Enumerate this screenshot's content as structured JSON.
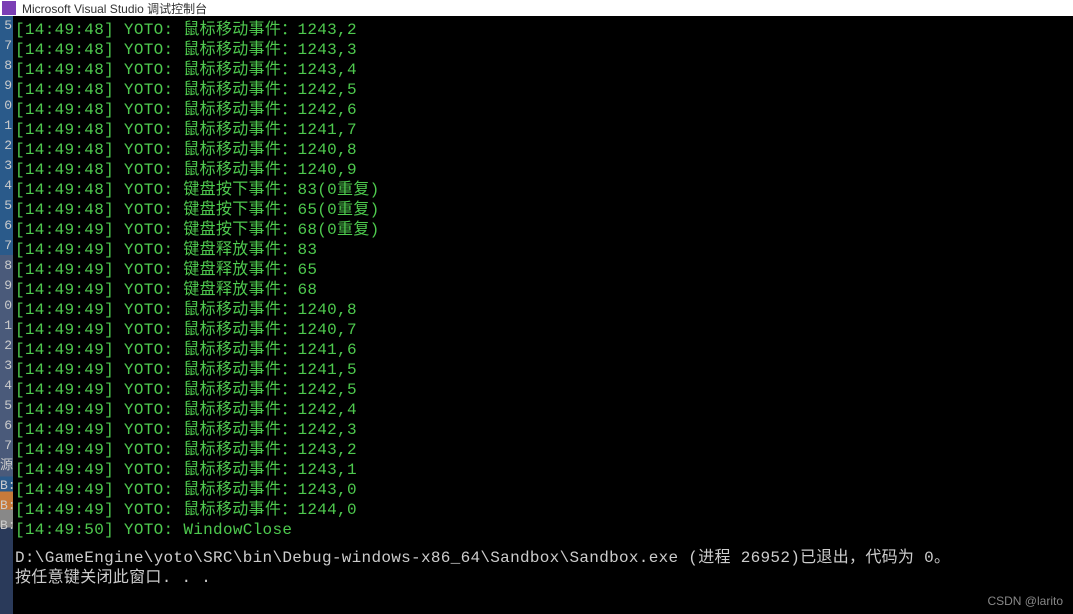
{
  "title": "Microsoft Visual Studio 调试控制台",
  "gutter": [
    "5",
    "7",
    "8",
    "9",
    "0",
    "1",
    "2",
    "3",
    "4",
    "5",
    "6",
    "7",
    "8",
    "9",
    "0",
    "1",
    "2",
    "3",
    "4",
    "5",
    "6",
    "7",
    "源",
    "B:",
    "B:",
    "B:"
  ],
  "logs": [
    {
      "ts": "[14:49:48]",
      "prefix": "YOTO:",
      "msg": "鼠标移动事件：1243,2"
    },
    {
      "ts": "[14:49:48]",
      "prefix": "YOTO:",
      "msg": "鼠标移动事件：1243,3"
    },
    {
      "ts": "[14:49:48]",
      "prefix": "YOTO:",
      "msg": "鼠标移动事件：1243,4"
    },
    {
      "ts": "[14:49:48]",
      "prefix": "YOTO:",
      "msg": "鼠标移动事件：1242,5"
    },
    {
      "ts": "[14:49:48]",
      "prefix": "YOTO:",
      "msg": "鼠标移动事件：1242,6"
    },
    {
      "ts": "[14:49:48]",
      "prefix": "YOTO:",
      "msg": "鼠标移动事件：1241,7"
    },
    {
      "ts": "[14:49:48]",
      "prefix": "YOTO:",
      "msg": "鼠标移动事件：1240,8"
    },
    {
      "ts": "[14:49:48]",
      "prefix": "YOTO:",
      "msg": "鼠标移动事件：1240,9"
    },
    {
      "ts": "[14:49:48]",
      "prefix": "YOTO:",
      "msg": "键盘按下事件：83(0重复)"
    },
    {
      "ts": "[14:49:48]",
      "prefix": "YOTO:",
      "msg": "键盘按下事件：65(0重复)"
    },
    {
      "ts": "[14:49:49]",
      "prefix": "YOTO:",
      "msg": "键盘按下事件：68(0重复)"
    },
    {
      "ts": "[14:49:49]",
      "prefix": "YOTO:",
      "msg": "键盘释放事件：83"
    },
    {
      "ts": "[14:49:49]",
      "prefix": "YOTO:",
      "msg": "键盘释放事件：65"
    },
    {
      "ts": "[14:49:49]",
      "prefix": "YOTO:",
      "msg": "键盘释放事件：68"
    },
    {
      "ts": "[14:49:49]",
      "prefix": "YOTO:",
      "msg": "鼠标移动事件：1240,8"
    },
    {
      "ts": "[14:49:49]",
      "prefix": "YOTO:",
      "msg": "鼠标移动事件：1240,7"
    },
    {
      "ts": "[14:49:49]",
      "prefix": "YOTO:",
      "msg": "鼠标移动事件：1241,6"
    },
    {
      "ts": "[14:49:49]",
      "prefix": "YOTO:",
      "msg": "鼠标移动事件：1241,5"
    },
    {
      "ts": "[14:49:49]",
      "prefix": "YOTO:",
      "msg": "鼠标移动事件：1242,5"
    },
    {
      "ts": "[14:49:49]",
      "prefix": "YOTO:",
      "msg": "鼠标移动事件：1242,4"
    },
    {
      "ts": "[14:49:49]",
      "prefix": "YOTO:",
      "msg": "鼠标移动事件：1242,3"
    },
    {
      "ts": "[14:49:49]",
      "prefix": "YOTO:",
      "msg": "鼠标移动事件：1243,2"
    },
    {
      "ts": "[14:49:49]",
      "prefix": "YOTO:",
      "msg": "鼠标移动事件：1243,1"
    },
    {
      "ts": "[14:49:49]",
      "prefix": "YOTO:",
      "msg": "鼠标移动事件：1243,0"
    },
    {
      "ts": "[14:49:49]",
      "prefix": "YOTO:",
      "msg": "鼠标移动事件：1244,0"
    },
    {
      "ts": "[14:49:50]",
      "prefix": "YOTO:",
      "msg": "WindowClose"
    }
  ],
  "exit_line": "D:\\GameEngine\\yoto\\SRC\\bin\\Debug-windows-x86_64\\Sandbox\\Sandbox.exe (进程 26952)已退出，代码为 0。",
  "prompt_line": "按任意键关闭此窗口. . .",
  "watermark": "CSDN @larito"
}
